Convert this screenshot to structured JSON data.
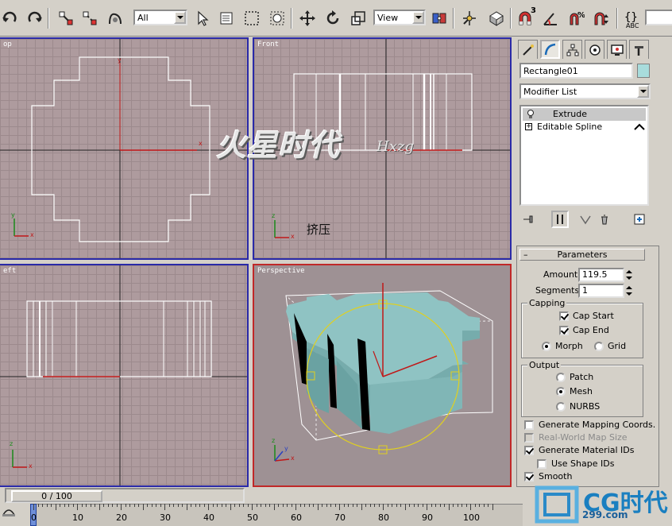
{
  "toolbar": {
    "selection_filter": "All",
    "coordinate_system": "View",
    "spinner_snap_sup": "3",
    "keyboard_shortcut_label": "ABC"
  },
  "viewports": {
    "top": {
      "label": "Top",
      "visible_label": "op",
      "axis_x": "x",
      "axis_y": "y"
    },
    "front": {
      "label": "Front",
      "axis_x": "x",
      "axis_y": "z"
    },
    "left": {
      "label": "Left",
      "visible_label": "eft",
      "axis_x": "x",
      "axis_y": "z"
    },
    "perspective": {
      "label": "Perspective",
      "axis_x": "x",
      "axis_y": "y",
      "axis_z": "z"
    }
  },
  "watermark": {
    "chinese": "火星时代",
    "latin": "Hxzg"
  },
  "annotation": "挤压",
  "command_panel": {
    "object_name": "Rectangle01",
    "object_color": "#a8dcdc",
    "modifier_list_label": "Modifier List",
    "modifier_stack": [
      {
        "label": "Extrude",
        "selected": true
      },
      {
        "label": "Editable Spline",
        "selected": false
      }
    ],
    "parameters": {
      "title": "Parameters",
      "amount_label": "Amount:",
      "amount_value": "119.5",
      "segments_label": "Segments:",
      "segments_value": "1",
      "capping": {
        "title": "Capping",
        "cap_start": "Cap Start",
        "cap_end": "Cap End",
        "morph": "Morph",
        "grid": "Grid"
      },
      "output": {
        "title": "Output",
        "patch": "Patch",
        "mesh": "Mesh",
        "nurbs": "NURBS"
      },
      "generate_mapping": "Generate Mapping Coords.",
      "real_world": "Real-World Map Size",
      "generate_material_ids": "Generate Material IDs",
      "use_shape_ids": "Use Shape IDs",
      "smooth": "Smooth"
    }
  },
  "timeline": {
    "slider_text": "0 / 100",
    "ticks": [
      "0",
      "10",
      "20",
      "30",
      "40",
      "50",
      "60",
      "70",
      "80",
      "90",
      "100"
    ]
  },
  "logo": {
    "text": "CG时代",
    "url": "299.com"
  }
}
